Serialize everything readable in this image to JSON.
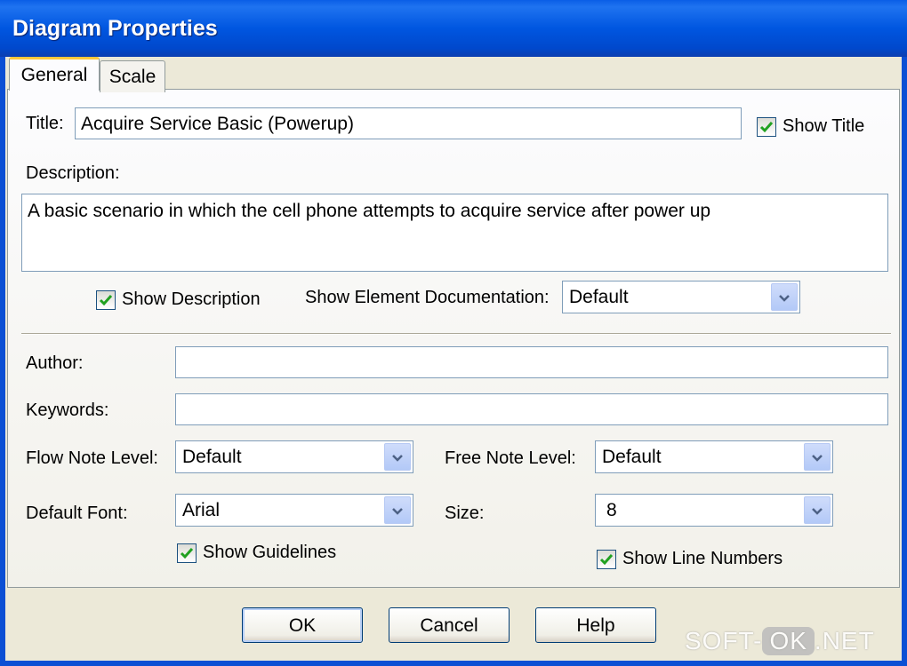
{
  "window": {
    "title": "Diagram Properties"
  },
  "tabs": [
    {
      "label": "General"
    },
    {
      "label": "Scale"
    }
  ],
  "general": {
    "title_label": "Title:",
    "title_value": "Acquire Service Basic (Powerup)",
    "show_title_label": "Show Title",
    "show_title_checked": true,
    "description_label": "Description:",
    "description_value": "A basic scenario in which the cell phone attempts to acquire service after power up",
    "show_description_label": "Show Description",
    "show_description_checked": true,
    "show_element_doc_label": "Show Element Documentation:",
    "show_element_doc_value": "Default",
    "author_label": "Author:",
    "author_value": "",
    "keywords_label": "Keywords:",
    "keywords_value": "",
    "flow_note_level_label": "Flow Note Level:",
    "flow_note_level_value": "Default",
    "free_note_level_label": "Free Note Level:",
    "free_note_level_value": "Default",
    "default_font_label": "Default Font:",
    "default_font_value": "Arial",
    "size_label": "Size:",
    "size_value": "8",
    "show_guidelines_label": "Show Guidelines",
    "show_guidelines_checked": true,
    "show_line_numbers_label": "Show Line Numbers",
    "show_line_numbers_checked": true
  },
  "buttons": {
    "ok": "OK",
    "cancel": "Cancel",
    "help": "Help"
  },
  "watermark": {
    "left": "SOFT-",
    "box": "OK",
    "right": ".NET"
  },
  "colors": {
    "titlebar": "#0054e3",
    "dialog_bg": "#ece9d8",
    "check": "#21a121",
    "field_border": "#7f9db9"
  }
}
